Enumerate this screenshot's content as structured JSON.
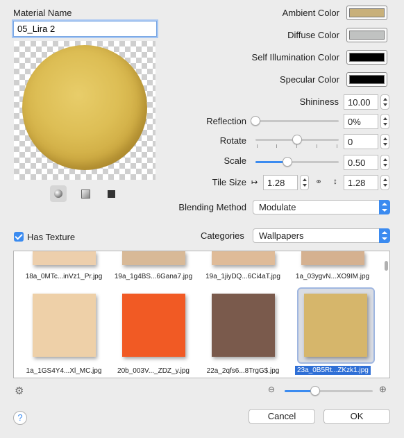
{
  "material": {
    "name_label": "Material Name",
    "name_value": "05_Lira 2"
  },
  "colors": {
    "ambient": {
      "label": "Ambient Color",
      "value": "#c8b07a"
    },
    "diffuse": {
      "label": "Diffuse Color",
      "value": "#c0c2c1"
    },
    "self_illumination": {
      "label": "Self Illumination Color",
      "value": "#000000"
    },
    "specular": {
      "label": "Specular Color",
      "value": "#000000"
    }
  },
  "shininess": {
    "label": "Shininess",
    "value": "10.00"
  },
  "reflection": {
    "label": "Reflection",
    "value": "0%",
    "level": 0
  },
  "rotate": {
    "label": "Rotate",
    "value": "0",
    "level": 0.5
  },
  "scale": {
    "label": "Scale",
    "value": "0.50",
    "level": 0.38
  },
  "tile_size": {
    "label": "Tile Size",
    "width_value": "1.28",
    "height_value": "1.28"
  },
  "blending": {
    "label": "Blending Method",
    "value": "Modulate"
  },
  "has_texture": {
    "label": "Has Texture",
    "checked": true
  },
  "categories": {
    "label": "Categories",
    "value": "Wallpapers"
  },
  "textures": [
    {
      "name": "18a_0MTc...inVz1_Pr.jpg",
      "color": "#edcfac"
    },
    {
      "name": "19a_1g4BS...6Gana7.jpg",
      "color": "#d8b997"
    },
    {
      "name": "19a_1jiyDQ...6Ci4aT.jpg",
      "color": "#dfbb98"
    },
    {
      "name": "1a_03ygvN...XO9IM.jpg",
      "color": "#d5b190"
    },
    {
      "name": "1a_1GS4Y4...Xl_MC.jpg",
      "color": "#eed0a8"
    },
    {
      "name": "20b_003V..._ZDZ_y.jpg",
      "color": "#f15a24"
    },
    {
      "name": "22a_2qfs6...8TrgG$.jpg",
      "color": "#7a5a4c"
    },
    {
      "name": "23a_0B5Rt...ZKzk1.jpg",
      "color": "#d6b66b"
    }
  ],
  "zoom": {
    "level": 0.35
  },
  "buttons": {
    "help": "?",
    "cancel": "Cancel",
    "ok": "OK"
  }
}
